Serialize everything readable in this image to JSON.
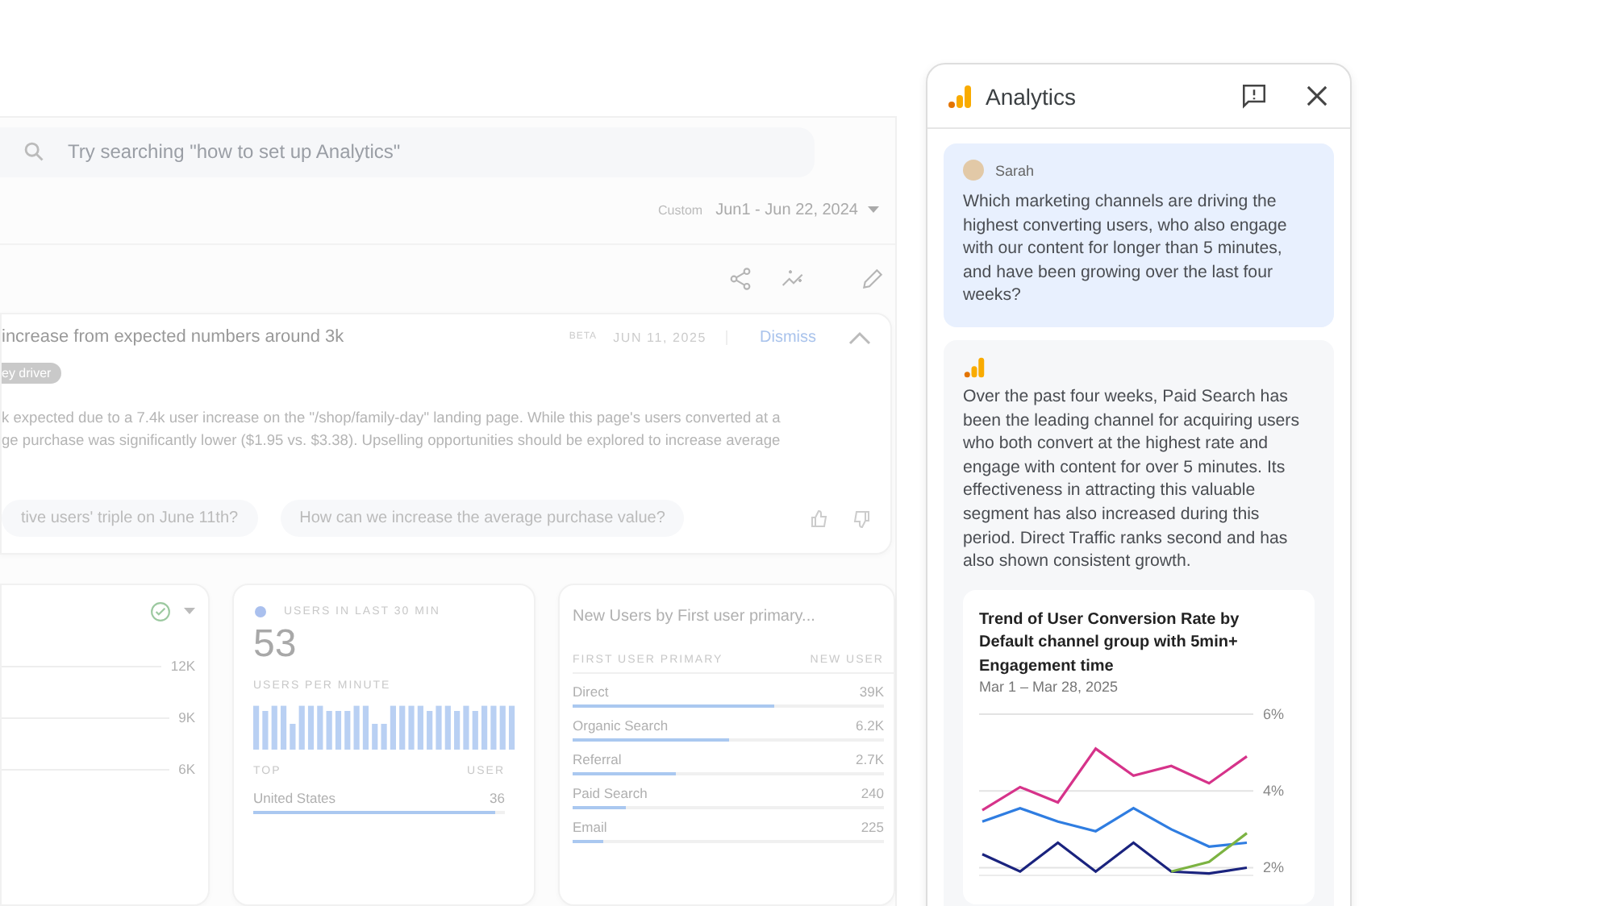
{
  "dashboard": {
    "search": {
      "placeholder": "Try searching \"how to set up Analytics\""
    },
    "date_range": {
      "label": "Custom",
      "value": "Jun1 - Jun 22, 2024"
    },
    "insight": {
      "title": "increase from expected numbers around 3k",
      "badge": "BETA",
      "date": "JUN 11, 2025",
      "dismiss": "Dismiss",
      "expanded": true,
      "tag": "ey driver",
      "body": [
        "k expected due to a 7.4k user increase on the \"/shop/family-day\" landing page. While this page's users converted at a",
        "ge purchase was significantly lower ($1.95 vs. $3.38).  Upselling opportunities should be explored to increase average"
      ],
      "suggestions": [
        "tive users' triple on June 11th?",
        "How can we increase the average purchase value?"
      ]
    },
    "trend_card": {
      "axis_labels": [
        "12K",
        "9K",
        "6K"
      ]
    },
    "realtime_card": {
      "title": "USERS IN LAST 30 MIN",
      "value": "53",
      "subtitle": "USERS PER MINUTE",
      "col_1": "TOP",
      "col_2": "USER",
      "rows": [
        {
          "name": "United States",
          "value": "36",
          "level": 0.96
        }
      ]
    },
    "channels_card": {
      "title": "New Users by First user primary...",
      "col_1": "FIRST USER PRIMARY",
      "col_2": "NEW USER",
      "rows": [
        {
          "name": "Direct",
          "value": "39K",
          "level": 0.65
        },
        {
          "name": "Organic Search",
          "value": "6.2K",
          "level": 0.5
        },
        {
          "name": "Referral",
          "value": "2.7K",
          "level": 0.33
        },
        {
          "name": "Paid Search",
          "value": "240",
          "level": 0.17
        },
        {
          "name": "Email",
          "value": "225",
          "level": 0.1
        }
      ]
    }
  },
  "assistant": {
    "title": "Analytics",
    "messages": [
      {
        "kind": "user",
        "author": "Sarah",
        "text": "Which marketing channels are driving the highest converting users, who also engage with our content for longer than 5 minutes, and have been growing over the last four weeks?"
      },
      {
        "kind": "answer",
        "text": "Over the past four weeks, Paid Search has been the leading channel for acquiring users who both convert at the highest rate and engage with content for over 5 minutes. Its effectiveness in attracting this valuable segment has also increased during this period. Direct Traffic ranks second and has also shown consistent growth.",
        "chart": {
          "subtitle": "Mar 1 – Mar 28, 2025",
          "chart_data": {
            "type": "line",
            "title": "Trend of User Conversion Rate by Default channel group with 5min+ Engagement time",
            "ylim": [
              1.8,
              6
            ],
            "yticks": [
              {
                "value": 2,
                "label": "2%"
              },
              {
                "value": 4,
                "label": "4%"
              },
              {
                "value": 6,
                "label": "6%"
              }
            ],
            "series": [
              {
                "color": "#d6338a",
                "values": [
                  3.5,
                  4.1,
                  3.7,
                  5.1,
                  4.4,
                  4.65,
                  4.2,
                  4.9
                ]
              },
              {
                "color": "#2f7de1",
                "values": [
                  3.2,
                  3.55,
                  3.2,
                  2.95,
                  3.55,
                  3.0,
                  2.55,
                  2.65
                ]
              },
              {
                "color": "#1a237e",
                "values": [
                  2.35,
                  1.9,
                  2.65,
                  1.9,
                  2.65,
                  1.9,
                  1.85,
                  2.0
                ]
              },
              {
                "color": "#7cb342",
                "values": [
                  null,
                  null,
                  null,
                  null,
                  null,
                  1.9,
                  2.15,
                  2.9
                ]
              }
            ]
          }
        }
      }
    ]
  }
}
